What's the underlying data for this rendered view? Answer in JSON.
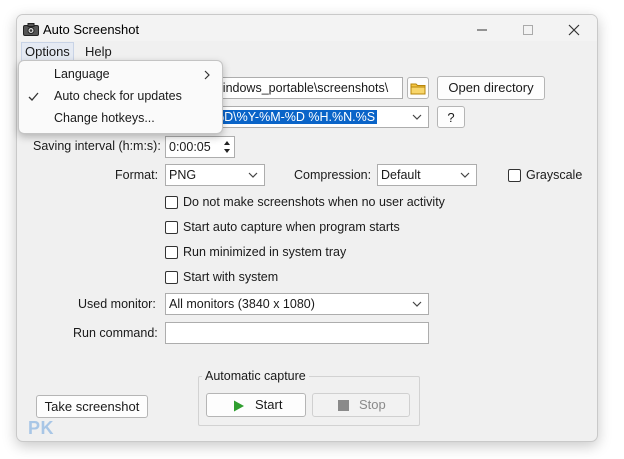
{
  "window": {
    "title": "Auto Screenshot",
    "controls": {
      "minimize": "minimize",
      "maximize": "maximize",
      "close": "close"
    }
  },
  "menubar": {
    "options": "Options",
    "help": "Help"
  },
  "options_menu": {
    "items": [
      {
        "label": "Language",
        "has_submenu": true,
        "checked": false
      },
      {
        "label": "Auto check for updates",
        "has_submenu": false,
        "checked": true
      },
      {
        "label": "Change hotkeys...",
        "has_submenu": false,
        "checked": false
      }
    ]
  },
  "form": {
    "output_dir_value": "Windows_portable\\screenshots\\",
    "open_directory_label": "Open directory",
    "filename_value": "%D\\%Y-%M-%D %H.%N.%S",
    "help_button_label": "?",
    "saving_interval_label": "Saving interval (h:m:s):",
    "saving_interval_value": "0:00:05",
    "format_label": "Format:",
    "format_value": "PNG",
    "compression_label": "Compression:",
    "compression_value": "Default",
    "grayscale_label": "Grayscale",
    "grayscale_checked": false,
    "options": [
      {
        "label": "Do not make screenshots when no user activity",
        "checked": false
      },
      {
        "label": "Start auto capture when program starts",
        "checked": false
      },
      {
        "label": "Run minimized in system tray",
        "checked": false
      },
      {
        "label": "Start with system",
        "checked": false
      }
    ],
    "used_monitor_label": "Used monitor:",
    "used_monitor_value": "All monitors (3840 x 1080)",
    "run_command_label": "Run command:",
    "run_command_value": ""
  },
  "bottom": {
    "take_screenshot_label": "Take screenshot",
    "auto_capture_group": "Automatic capture",
    "start_label": "Start",
    "stop_label": "Stop"
  },
  "watermark": "PK",
  "colors": {
    "accent": "#0a64c8",
    "start_icon": "#2f9e2f",
    "stop_icon": "#8a8a8a"
  }
}
